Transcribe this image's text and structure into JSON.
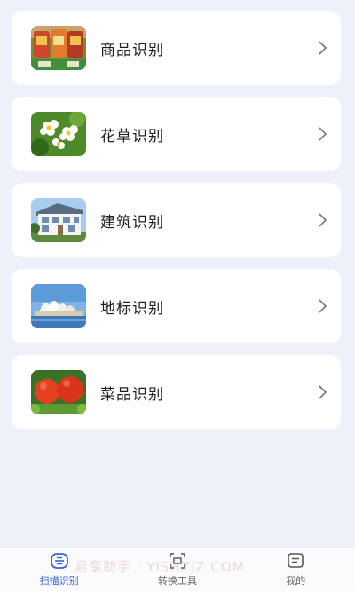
{
  "items": [
    {
      "label": "商品识别",
      "thumb": "grocery-products-photo"
    },
    {
      "label": "花草识别",
      "thumb": "flowers-photo"
    },
    {
      "label": "建筑识别",
      "thumb": "building-photo"
    },
    {
      "label": "地标识别",
      "thumb": "landmark-opera-house-photo"
    },
    {
      "label": "菜品识别",
      "thumb": "tomato-dish-photo"
    }
  ],
  "tabs": [
    {
      "label": "扫描识别",
      "icon": "scan-icon",
      "active": true
    },
    {
      "label": "转换工具",
      "icon": "convert-icon",
      "active": false
    },
    {
      "label": "我的",
      "icon": "profile-icon",
      "active": false
    }
  ],
  "watermark": "易享助手 · YISHZIZ.COM",
  "colors": {
    "background": "#eef0fa",
    "card": "#ffffff",
    "accent": "#3a62d8",
    "text": "#1f1f1f"
  }
}
